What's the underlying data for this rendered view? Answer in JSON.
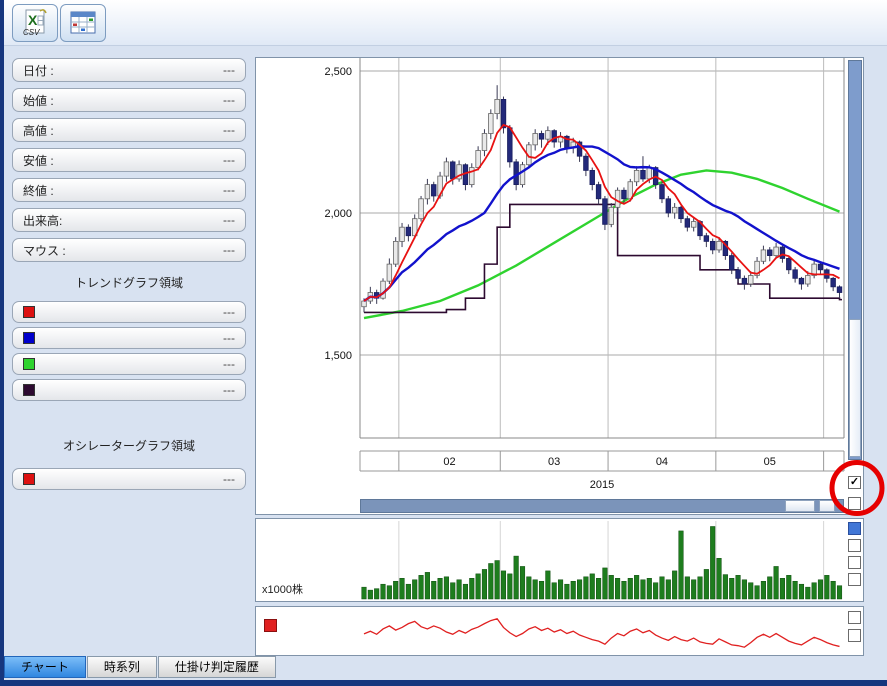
{
  "toolbar": {
    "csv_button": {
      "x_glyph": "X",
      "csv_label": "CSV"
    }
  },
  "icons": {
    "check": "✓"
  },
  "info_panel": {
    "fields": [
      {
        "label": "日付 :",
        "value": "---"
      },
      {
        "label": "始値 :",
        "value": "---"
      },
      {
        "label": "高値 :",
        "value": "---"
      },
      {
        "label": "安値 :",
        "value": "---"
      },
      {
        "label": "終値 :",
        "value": "---"
      },
      {
        "label": "出来高:",
        "value": "---"
      },
      {
        "label": "マウス :",
        "value": "---"
      }
    ],
    "trend_section_title": "トレンドグラフ領域",
    "trend_legends": [
      {
        "color": "#dd1111",
        "value": "---"
      },
      {
        "color": "#0000cc",
        "value": "---"
      },
      {
        "color": "#2fd32f",
        "value": "---"
      },
      {
        "color": "#2d0a30",
        "value": "---"
      }
    ],
    "osc_section_title": "オシレーターグラフ領域",
    "osc_legends": [
      {
        "color": "#dd1111",
        "value": "---"
      }
    ]
  },
  "volume_panel": {
    "unit_label": "x1000株"
  },
  "main_chart_checkboxes": [
    true,
    false
  ],
  "volume_checkboxes": [
    false,
    false,
    false
  ],
  "osc_checkboxes": [
    false,
    false
  ],
  "tabs": [
    {
      "label": "チャート",
      "name": "chart",
      "active": true
    },
    {
      "label": "時系列",
      "name": "time-series",
      "active": false
    },
    {
      "label": "仕掛け判定履歴",
      "name": "trade-signal-history",
      "active": false
    }
  ],
  "chart_data": {
    "type": "candlestick",
    "price": {
      "y_ticks": [
        {
          "label": "2,500",
          "value": 2500
        },
        {
          "label": "2,000",
          "value": 2000
        },
        {
          "label": "1,500",
          "value": 1500
        }
      ],
      "year_label": "2015",
      "month_labels": [
        "02",
        "03",
        "04",
        "05"
      ],
      "month_boundaries": [
        6,
        22,
        39,
        56,
        73
      ],
      "ma_short_window": 5,
      "ma_mid_window": 20,
      "line_colors": {
        "short_ma": "#e81212",
        "mid_ma": "#1212cc",
        "long_ma": "#2fd32f",
        "stop_line": "#2d0a30"
      },
      "candles": [
        [
          1670,
          1700,
          1650,
          1690
        ],
        [
          1690,
          1740,
          1680,
          1720
        ],
        [
          1720,
          1730,
          1680,
          1700
        ],
        [
          1700,
          1770,
          1695,
          1760
        ],
        [
          1760,
          1840,
          1750,
          1820
        ],
        [
          1820,
          1915,
          1810,
          1900
        ],
        [
          1900,
          1965,
          1880,
          1950
        ],
        [
          1950,
          1960,
          1900,
          1920
        ],
        [
          1920,
          1995,
          1910,
          1980
        ],
        [
          1980,
          2060,
          1970,
          2050
        ],
        [
          2050,
          2120,
          2030,
          2100
        ],
        [
          2100,
          2110,
          2040,
          2060
        ],
        [
          2060,
          2145,
          2050,
          2130
        ],
        [
          2130,
          2195,
          2110,
          2180
        ],
        [
          2180,
          2185,
          2100,
          2120
        ],
        [
          2120,
          2185,
          2110,
          2170
        ],
        [
          2170,
          2175,
          2080,
          2100
        ],
        [
          2100,
          2175,
          2090,
          2160
        ],
        [
          2160,
          2235,
          2150,
          2220
        ],
        [
          2220,
          2295,
          2200,
          2280
        ],
        [
          2280,
          2365,
          2260,
          2350
        ],
        [
          2350,
          2450,
          2330,
          2400
        ],
        [
          2400,
          2410,
          2280,
          2300
        ],
        [
          2300,
          2310,
          2160,
          2180
        ],
        [
          2180,
          2190,
          2080,
          2100
        ],
        [
          2100,
          2180,
          2090,
          2170
        ],
        [
          2170,
          2250,
          2160,
          2240
        ],
        [
          2240,
          2295,
          2220,
          2280
        ],
        [
          2280,
          2290,
          2230,
          2260
        ],
        [
          2260,
          2305,
          2240,
          2290
        ],
        [
          2290,
          2295,
          2230,
          2250
        ],
        [
          2250,
          2285,
          2230,
          2270
        ],
        [
          2270,
          2275,
          2210,
          2230
        ],
        [
          2230,
          2265,
          2210,
          2250
        ],
        [
          2250,
          2255,
          2180,
          2200
        ],
        [
          2200,
          2210,
          2130,
          2150
        ],
        [
          2150,
          2160,
          2080,
          2100
        ],
        [
          2100,
          2110,
          2030,
          2050
        ],
        [
          2050,
          2060,
          1940,
          1960
        ],
        [
          1960,
          2035,
          1950,
          2020
        ],
        [
          2020,
          2090,
          2005,
          2080
        ],
        [
          2080,
          2090,
          2030,
          2050
        ],
        [
          2050,
          2120,
          2040,
          2110
        ],
        [
          2110,
          2165,
          2095,
          2150
        ],
        [
          2150,
          2200,
          2110,
          2120
        ],
        [
          2120,
          2170,
          2105,
          2160
        ],
        [
          2160,
          2165,
          2085,
          2100
        ],
        [
          2100,
          2110,
          2035,
          2050
        ],
        [
          2050,
          2060,
          1985,
          2000
        ],
        [
          2000,
          2035,
          1980,
          2020
        ],
        [
          2020,
          2025,
          1965,
          1980
        ],
        [
          1980,
          1990,
          1935,
          1950
        ],
        [
          1950,
          1985,
          1935,
          1970
        ],
        [
          1970,
          1975,
          1905,
          1920
        ],
        [
          1920,
          1930,
          1880,
          1900
        ],
        [
          1900,
          1910,
          1855,
          1870
        ],
        [
          1870,
          1915,
          1860,
          1900
        ],
        [
          1900,
          1905,
          1835,
          1850
        ],
        [
          1850,
          1860,
          1785,
          1800
        ],
        [
          1800,
          1810,
          1755,
          1770
        ],
        [
          1770,
          1780,
          1730,
          1750
        ],
        [
          1750,
          1795,
          1740,
          1780
        ],
        [
          1780,
          1845,
          1770,
          1830
        ],
        [
          1830,
          1885,
          1820,
          1870
        ],
        [
          1870,
          1880,
          1830,
          1850
        ],
        [
          1850,
          1895,
          1840,
          1880
        ],
        [
          1880,
          1885,
          1825,
          1840
        ],
        [
          1840,
          1845,
          1785,
          1800
        ],
        [
          1800,
          1810,
          1755,
          1770
        ],
        [
          1770,
          1775,
          1730,
          1750
        ],
        [
          1750,
          1795,
          1740,
          1780
        ],
        [
          1780,
          1835,
          1770,
          1820
        ],
        [
          1820,
          1825,
          1785,
          1800
        ],
        [
          1800,
          1805,
          1755,
          1770
        ],
        [
          1770,
          1775,
          1725,
          1740
        ],
        [
          1740,
          1745,
          1700,
          1720
        ]
      ],
      "green_line": [
        [
          0,
          1630
        ],
        [
          6,
          1655
        ],
        [
          12,
          1690
        ],
        [
          18,
          1745
        ],
        [
          24,
          1815
        ],
        [
          30,
          1895
        ],
        [
          36,
          1975
        ],
        [
          42,
          2055
        ],
        [
          46,
          2100
        ],
        [
          50,
          2135
        ],
        [
          54,
          2150
        ],
        [
          58,
          2142
        ],
        [
          62,
          2120
        ],
        [
          66,
          2088
        ],
        [
          70,
          2050
        ],
        [
          75,
          2005
        ]
      ],
      "purple_steps": [
        [
          0,
          1650
        ],
        [
          13,
          1660
        ],
        [
          16,
          1700
        ],
        [
          19,
          1820
        ],
        [
          21,
          1950
        ],
        [
          23,
          2030
        ],
        [
          40,
          1850
        ],
        [
          53,
          1800
        ],
        [
          59,
          1750
        ],
        [
          64,
          1700
        ],
        [
          75,
          1695
        ]
      ]
    },
    "volume": {
      "bar_color": "#1e7d1e",
      "values": [
        16,
        12,
        14,
        20,
        18,
        24,
        28,
        20,
        26,
        32,
        36,
        24,
        28,
        30,
        22,
        26,
        20,
        28,
        34,
        40,
        48,
        52,
        38,
        34,
        58,
        44,
        30,
        26,
        24,
        38,
        22,
        26,
        20,
        24,
        26,
        30,
        34,
        28,
        42,
        32,
        28,
        24,
        28,
        32,
        26,
        28,
        22,
        30,
        26,
        38,
        92,
        30,
        26,
        30,
        40,
        98,
        55,
        33,
        28,
        32,
        26,
        22,
        18,
        24,
        30,
        44,
        28,
        32,
        24,
        20,
        16,
        22,
        26,
        32,
        24,
        18
      ]
    },
    "oscillator": {
      "line_color": "#e02020",
      "values": [
        0.45,
        0.52,
        0.44,
        0.58,
        0.66,
        0.55,
        0.62,
        0.72,
        0.78,
        0.64,
        0.58,
        0.66,
        0.6,
        0.5,
        0.44,
        0.54,
        0.47,
        0.57,
        0.63,
        0.72,
        0.8,
        0.85,
        0.62,
        0.48,
        0.38,
        0.46,
        0.58,
        0.64,
        0.54,
        0.6,
        0.5,
        0.56,
        0.46,
        0.52,
        0.42,
        0.36,
        0.3,
        0.26,
        0.18,
        0.34,
        0.46,
        0.4,
        0.52,
        0.58,
        0.48,
        0.54,
        0.42,
        0.34,
        0.28,
        0.38,
        0.3,
        0.26,
        0.34,
        0.24,
        0.2,
        0.18,
        0.32,
        0.24,
        0.16,
        0.14,
        0.1,
        0.22,
        0.36,
        0.44,
        0.36,
        0.46,
        0.36,
        0.26,
        0.2,
        0.16,
        0.26,
        0.36,
        0.3,
        0.22,
        0.16,
        0.12
      ]
    }
  }
}
